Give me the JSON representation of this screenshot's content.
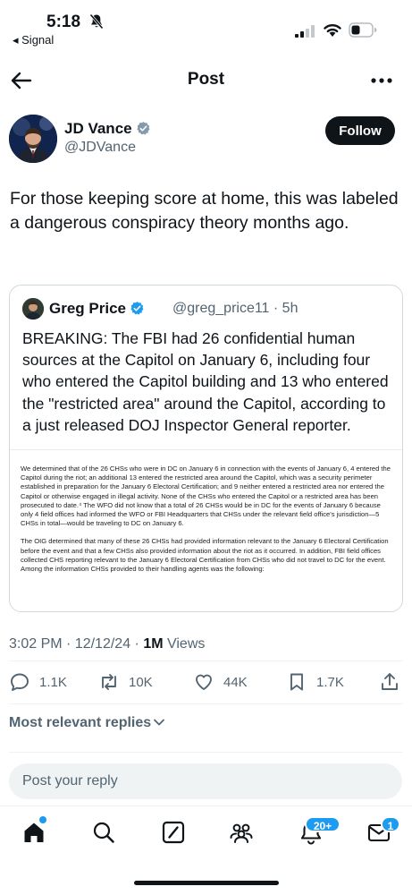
{
  "status_bar": {
    "time": "5:18",
    "back_app": "◂ Signal"
  },
  "header": {
    "title": "Post"
  },
  "author": {
    "name": "JD Vance",
    "handle": "@JDVance",
    "follow_label": "Follow"
  },
  "post": {
    "text": "For those keeping score at home, this was labeled a dangerous conspiracy theory months ago.",
    "timestamp": "3:02 PM · 12/12/24 · ",
    "views_count": "1M",
    "views_label": " Views"
  },
  "quote": {
    "name": "Greg Price",
    "handle_time": "@greg_price11 · 5h",
    "text": "BREAKING: The FBI had 26 confidential human sources at the Capitol on January 6, including four who entered the Capitol building and 13 who entered the \"restricted area\" around the Capitol, according to a just released DOJ Inspector General reporter.",
    "doc_paragraph_1": "We determined that of the 26 CHSs who were in DC on January 6 in connection with the events of January 6, 4 entered the Capitol during the riot; an additional 13 entered the restricted area around the Capitol, which was a security perimeter established in preparation for the January 6 Electoral Certification; and 9 neither entered a restricted area nor entered the Capitol or otherwise engaged in illegal activity.  None of the CHSs who entered the Capitol or a restricted area has been prosecuted to date.⁴  The WFO did not know that a total of 26 CHSs would be in DC for the events of January 6 because only 4 field offices had informed the WFO or FBI Headquarters that CHSs under the relevant field office's jurisdiction—5 CHSs in total—would be traveling to DC on January 6.",
    "doc_paragraph_2": "The OIG determined that many of these 26 CHSs had provided information relevant to the January 6 Electoral Certification before the event and that a few CHSs also provided information about the riot as it occurred.  In addition, FBI field offices collected CHS reporting relevant to the January 6 Electoral Certification from CHSs who did not travel to DC for the event.  Among the information CHSs provided to their handling agents was the following:"
  },
  "actions": {
    "replies": "1.1K",
    "reposts": "10K",
    "likes": "44K",
    "bookmarks": "1.7K"
  },
  "replies_filter": "Most relevant replies",
  "reply_placeholder": "Post your reply",
  "tab_bar": {
    "notifications_badge": "20+",
    "messages_badge": "1"
  },
  "colors": {
    "accent": "#1d9bf0",
    "text": "#0f1419",
    "secondary_text": "#536471",
    "border": "#cfd9de"
  },
  "icons": {
    "bell": "bell-slash-icon",
    "back": "arrow-left-icon",
    "more": "more-horizontal-icon",
    "verified": "verified-badge-icon",
    "reply": "reply-icon",
    "repost": "repost-icon",
    "like": "heart-icon",
    "bookmark": "bookmark-icon",
    "share": "share-icon"
  }
}
